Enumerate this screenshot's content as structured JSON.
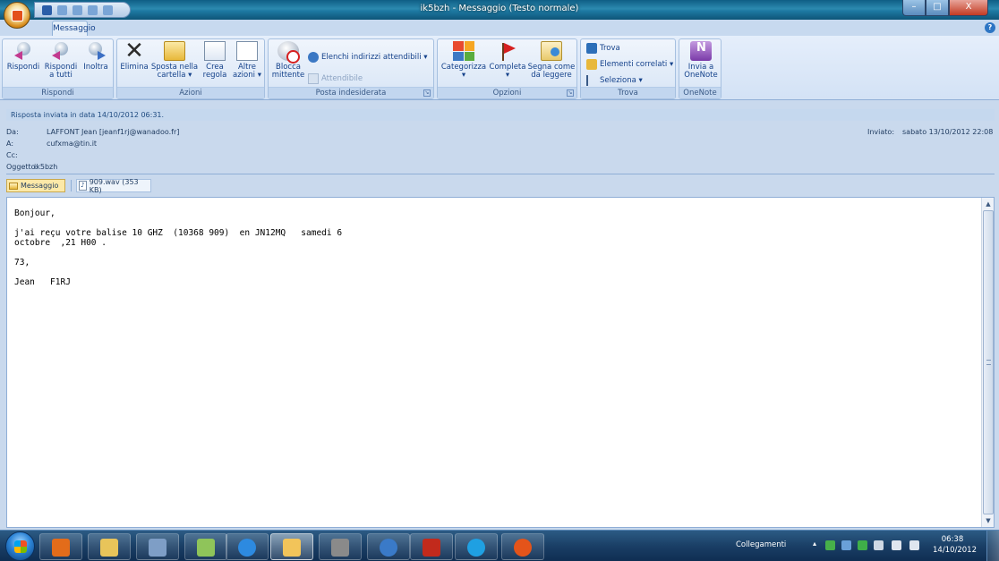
{
  "window": {
    "title": "ik5bzh - Messaggio (Testo normale)",
    "controls": [
      "–",
      "□",
      "X"
    ]
  },
  "tabs": [
    {
      "label": "Messaggio"
    }
  ],
  "help": "?",
  "ribbon": {
    "groups": {
      "rispondi": "Rispondi",
      "azioni": "Azioni",
      "posta": "Posta indesiderata",
      "opzioni": "Opzioni",
      "trova": "Trova",
      "onenote": "OneNote"
    },
    "buttons": {
      "rispondi": [
        "Rispondi",
        ""
      ],
      "rispondi_tutti": [
        "Rispondi",
        "a tutti"
      ],
      "inoltra": [
        "Inoltra",
        ""
      ],
      "elimina": [
        "Elimina",
        ""
      ],
      "sposta": [
        "Sposta nella",
        "cartella ▾"
      ],
      "crea": [
        "Crea",
        "regola"
      ],
      "altre": [
        "Altre",
        "azioni ▾"
      ],
      "blocca": [
        "Blocca",
        "mittente"
      ],
      "elenchi": "Elenchi indirizzi attendibili ▾",
      "attendibile": "Attendibile",
      "categorizza": [
        "Categorizza",
        "▾"
      ],
      "completa": [
        "Completa",
        "▾"
      ],
      "segna": [
        "Segna come",
        "da leggere"
      ],
      "trova": "Trova",
      "correlati": "Elementi correlati ▾",
      "seleziona": "Seleziona ▾",
      "invia_onenote": [
        "Invia a",
        "OneNote"
      ]
    }
  },
  "message": {
    "info": "Risposta inviata in data 14/10/2012 06:31.",
    "from_label": "Da:",
    "from": "LAFFONT Jean [jeanf1rj@wanadoo.fr]",
    "to_label": "A:",
    "to": "cufxma@tin.it",
    "cc_label": "Cc:",
    "cc": "",
    "subject_label": "Oggetto:",
    "subject": "ik5bzh",
    "sent_label": "Inviato:",
    "sent": "sabato 13/10/2012 22:08",
    "attachments": {
      "message_tab": "Messaggio",
      "file": "909.wav (353 KB)"
    },
    "body": "Bonjour,\n\nj'ai reçu votre balise 10 GHZ  (10368 909)  en JN12MQ   samedi 6\noctobre  ,21 H00 .\n\n73,\n\nJean   F1RJ"
  },
  "taskbar": {
    "tray_label": "Collegamenti",
    "tray_chevron": "▴",
    "time": "06:38",
    "date": "14/10/2012"
  },
  "colors": {
    "ribbon_bg": "#dce8f7",
    "title_bar": "#1e7aa3",
    "accent_text": "#15428b",
    "taskbar": "#1a3f66"
  }
}
